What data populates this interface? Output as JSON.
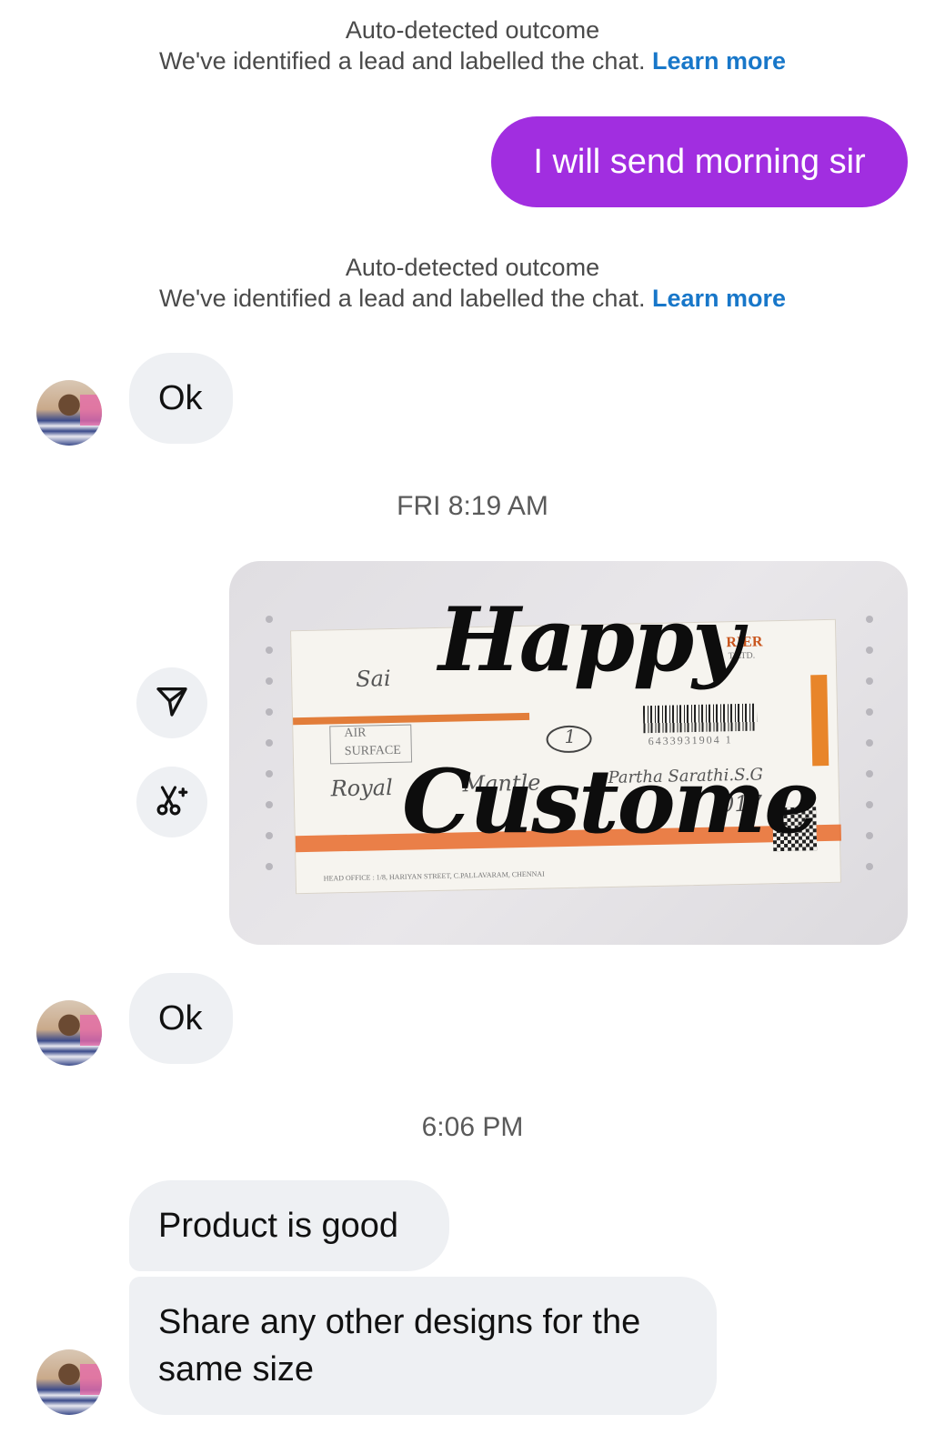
{
  "notices": [
    {
      "title": "Auto-detected outcome",
      "body": "We've identified a lead and labelled the chat.",
      "link": "Learn more"
    },
    {
      "title": "Auto-detected outcome",
      "body": "We've identified a lead and labelled the chat.",
      "link": "Learn more"
    }
  ],
  "messages": {
    "outgoing_1": "I will send morning sir",
    "incoming_ok_1": "Ok",
    "incoming_ok_2": "Ok",
    "incoming_product": "Product is good",
    "incoming_share": "Share any other designs for the same size"
  },
  "timestamps": {
    "t1": "FRI 8:19 AM",
    "t2": "6:06 PM"
  },
  "media": {
    "overlay_line1": "Happy",
    "overlay_line2": "Custome",
    "barcode_number": "6433931904 1",
    "slip_texts": {
      "sai": "Sai",
      "air": "AIR",
      "surface": "SURFACE",
      "royal": "Royal",
      "mantle": "Mantle",
      "rier": "RIER",
      "ltd": "T LTD.",
      "sarathi": "Partha Sarathi.S.G",
      "num": "017",
      "one": "1",
      "head_office": "HEAD OFFICE : 1/8, HARIYAN STREET, C.PALLAVARAM, CHENNAI"
    }
  },
  "actions": {
    "share_icon": "paper-plane-icon",
    "edit_icon": "scissors-sparkle-icon"
  },
  "colors": {
    "outgoing_bubble": "#a12ee0",
    "incoming_bubble": "#eef0f3",
    "link": "#1877c9"
  }
}
